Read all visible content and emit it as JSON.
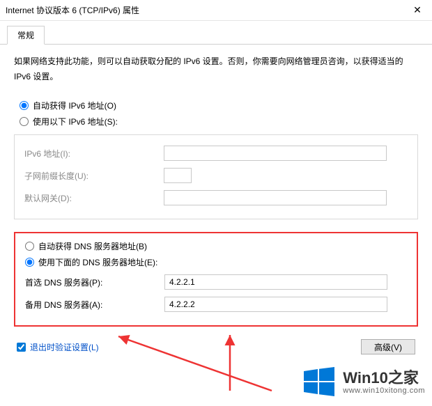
{
  "window": {
    "title": "Internet 协议版本 6 (TCP/IPv6) 属性",
    "close_glyph": "✕"
  },
  "tabs": {
    "general": "常规"
  },
  "description": "如果网络支持此功能，则可以自动获取分配的 IPv6 设置。否则，你需要向网络管理员咨询，以获得适当的 IPv6 设置。",
  "ip_section": {
    "auto_label": "自动获得 IPv6 地址(O)",
    "manual_label": "使用以下 IPv6 地址(S):",
    "addr_label": "IPv6 地址(I):",
    "prefix_label": "子网前缀长度(U):",
    "gateway_label": "默认网关(D):"
  },
  "dns_section": {
    "auto_label": "自动获得 DNS 服务器地址(B)",
    "manual_label": "使用下面的 DNS 服务器地址(E):",
    "preferred_label": "首选 DNS 服务器(P):",
    "alternate_label": "备用 DNS 服务器(A):",
    "preferred_value": "4.2.2.1",
    "alternate_value": "4.2.2.2"
  },
  "footer": {
    "validate_label": "退出时验证设置(L)",
    "advanced_label": "高级(V)"
  },
  "watermark": {
    "text_big": "Win10之家",
    "text_small": "www.win10xitong.com",
    "logo_color": "#0078d7"
  }
}
